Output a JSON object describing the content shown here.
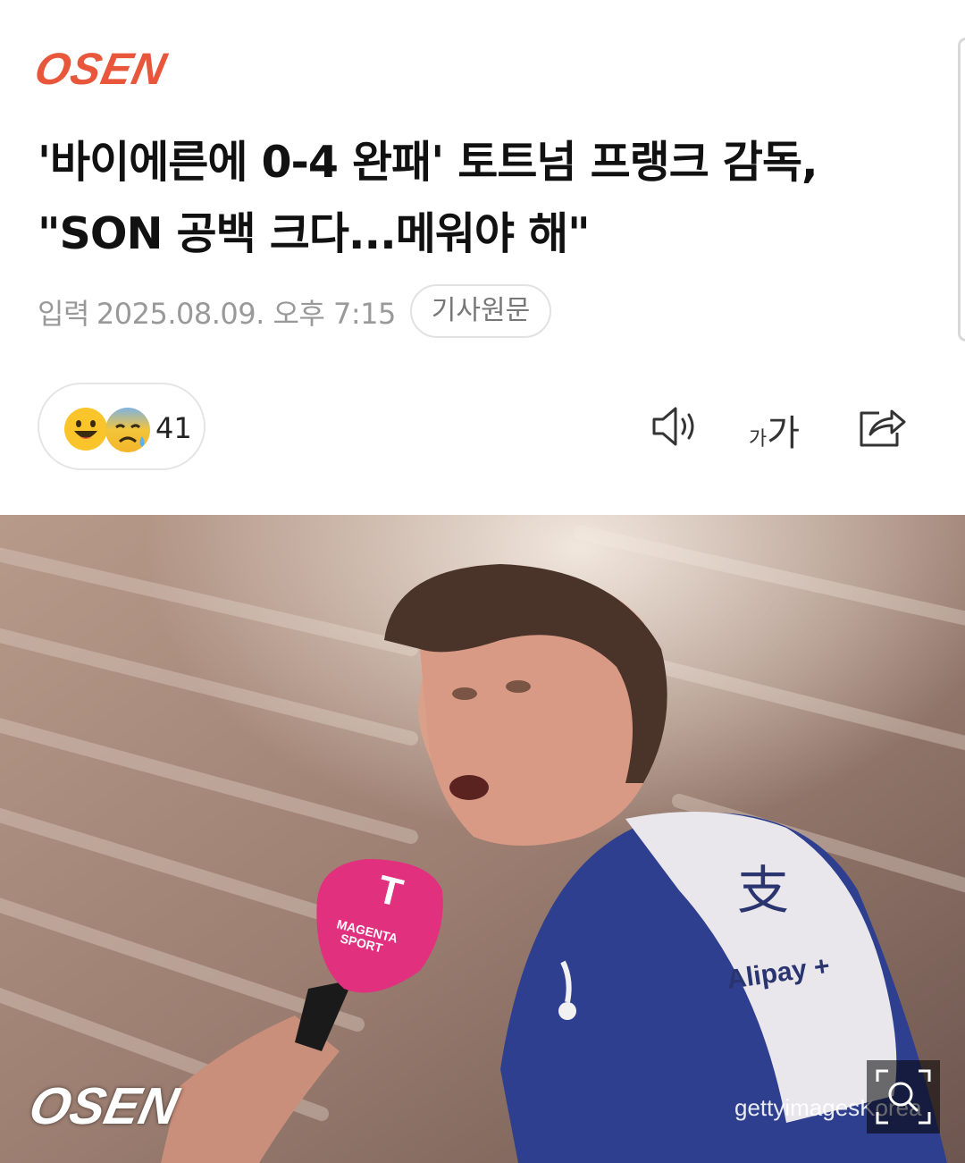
{
  "header": {
    "logo": "OSEN"
  },
  "article": {
    "title": "'바이에른에 0-4 완패' 토트넘 프랭크 감독, \"SON 공백 크다...메워야 해\"",
    "date_label": "입력",
    "date": "2025.08.09. 오후 7:15",
    "source_button": "기사원문"
  },
  "reactions": {
    "emojis": [
      "smile-emoji-icon",
      "sad-sweat-emoji-icon"
    ],
    "count": "41"
  },
  "toolbar": {
    "font_small": "가",
    "font_big": "가",
    "icons": [
      "speaker-icon",
      "font-size-icon",
      "share-icon"
    ]
  },
  "photo": {
    "watermark": "OSEN",
    "credit": "gettyimagesKorea",
    "mic_text": "MAGENTA SPORT",
    "sponsor": "Alipay +",
    "zoom_icon": "zoom-icon"
  }
}
